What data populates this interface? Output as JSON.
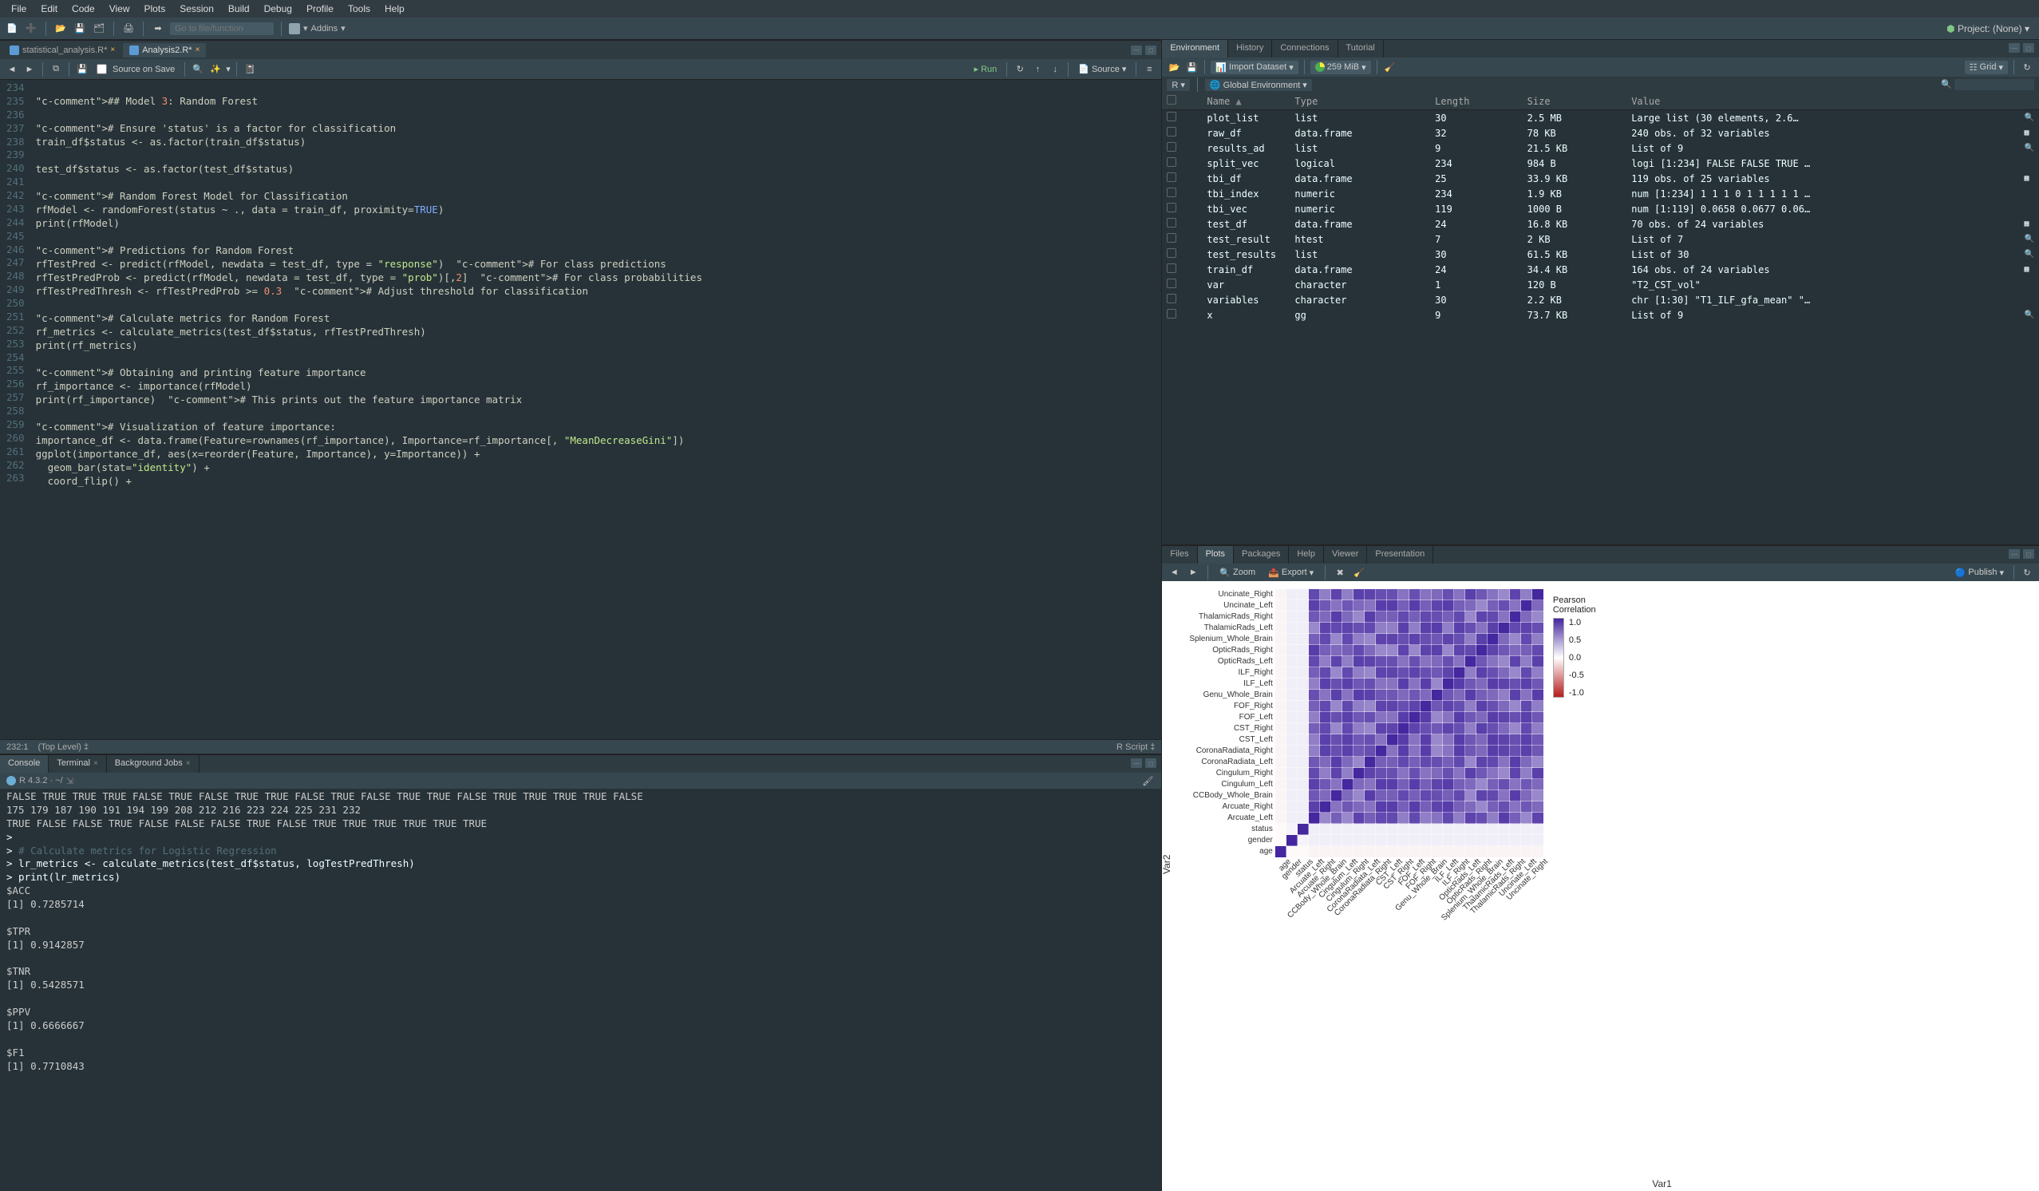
{
  "menu": [
    "File",
    "Edit",
    "Code",
    "View",
    "Plots",
    "Session",
    "Build",
    "Debug",
    "Profile",
    "Tools",
    "Help"
  ],
  "goto_placeholder": "Go to file/function",
  "addins_label": "Addins",
  "project_label": "Project: (None)",
  "editor": {
    "tabs": [
      "statistical_analysis.R*",
      "Analysis2.R*"
    ],
    "active_tab": 1,
    "source_on_save": "Source on Save",
    "run_label": "Run",
    "source_label": "Source",
    "cursor": "232:1",
    "scope": "(Top Level)",
    "lang": "R Script",
    "first_line": 234,
    "lines": [
      "",
      "## Model 3: Random Forest",
      "",
      "# Ensure 'status' is a factor for classification",
      "train_df$status <- as.factor(train_df$status)",
      "",
      "test_df$status <- as.factor(test_df$status)",
      "",
      "# Random Forest Model for Classification",
      "rfModel <- randomForest(status ~ ., data = train_df, proximity=TRUE)",
      "print(rfModel)",
      "",
      "# Predictions for Random Forest",
      "rfTestPred <- predict(rfModel, newdata = test_df, type = \"response\")  # For class predictions",
      "rfTestPredProb <- predict(rfModel, newdata = test_df, type = \"prob\")[,2]  # For class probabilities",
      "rfTestPredThresh <- rfTestPredProb >= 0.3  # Adjust threshold for classification",
      "",
      "# Calculate metrics for Random Forest",
      "rf_metrics <- calculate_metrics(test_df$status, rfTestPredThresh)",
      "print(rf_metrics)",
      "",
      "# Obtaining and printing feature importance",
      "rf_importance <- importance(rfModel)",
      "print(rf_importance)  # This prints out the feature importance matrix",
      "",
      "# Visualization of feature importance:",
      "importance_df <- data.frame(Feature=rownames(rf_importance), Importance=rf_importance[, \"MeanDecreaseGini\"])",
      "ggplot(importance_df, aes(x=reorder(Feature, Importance), y=Importance)) +",
      "  geom_bar(stat=\"identity\") +",
      "  coord_flip() +"
    ]
  },
  "console": {
    "tabs": [
      "Console",
      "Terminal",
      "Background Jobs"
    ],
    "version": "R 4.3.2 · ~/",
    "lines": [
      "FALSE  TRUE  TRUE  TRUE FALSE  TRUE FALSE  TRUE  TRUE FALSE  TRUE FALSE  TRUE  TRUE FALSE  TRUE  TRUE  TRUE  TRUE FALSE",
      "  175   179   187   190   191   194   199   208   212   216   223   224   225   231   232",
      " TRUE FALSE FALSE  TRUE FALSE FALSE FALSE  TRUE FALSE  TRUE  TRUE  TRUE  TRUE  TRUE  TRUE",
      ">",
      "> # Calculate metrics for Logistic Regression",
      "> lr_metrics <- calculate_metrics(test_df$status, logTestPredThresh)",
      "> print(lr_metrics)",
      "$ACC",
      "[1] 0.7285714",
      "",
      "$TPR",
      "[1] 0.9142857",
      "",
      "$TNR",
      "[1] 0.5428571",
      "",
      "$PPV",
      "[1] 0.6666667",
      "",
      "$F1",
      "[1] 0.7710843"
    ]
  },
  "env": {
    "tabs": [
      "Environment",
      "History",
      "Connections",
      "Tutorial"
    ],
    "import_label": "Import Dataset",
    "mem": "259 MiB",
    "view_label": "Grid",
    "scope": "Global Environment",
    "r_label": "R",
    "headers": [
      "",
      "Name",
      "Type",
      "Length",
      "Size",
      "Value"
    ],
    "rows": [
      {
        "name": "plot_list",
        "type": "list",
        "length": "30",
        "size": "2.5 MB",
        "value": "Large list (30 elements, 2.6…",
        "mag": true
      },
      {
        "name": "raw_df",
        "type": "data.frame",
        "length": "32",
        "size": "78 KB",
        "value": "240 obs. of 32 variables",
        "mag": false,
        "grid": true
      },
      {
        "name": "results_ad",
        "type": "list",
        "length": "9",
        "size": "21.5 KB",
        "value": "List of 9",
        "mag": true
      },
      {
        "name": "split_vec",
        "type": "logical",
        "length": "234",
        "size": "984 B",
        "value": "logi [1:234] FALSE FALSE TRUE …",
        "mag": false
      },
      {
        "name": "tbi_df",
        "type": "data.frame",
        "length": "25",
        "size": "33.9 KB",
        "value": "119 obs. of 25 variables",
        "mag": false,
        "grid": true
      },
      {
        "name": "tbi_index",
        "type": "numeric",
        "length": "234",
        "size": "1.9 KB",
        "value": "num [1:234] 1 1 1 0 1 1 1 1 1 …",
        "mag": false
      },
      {
        "name": "tbi_vec",
        "type": "numeric",
        "length": "119",
        "size": "1000 B",
        "value": "num [1:119] 0.0658 0.0677 0.06…",
        "mag": false
      },
      {
        "name": "test_df",
        "type": "data.frame",
        "length": "24",
        "size": "16.8 KB",
        "value": "70 obs. of 24 variables",
        "mag": false,
        "grid": true
      },
      {
        "name": "test_result",
        "type": "htest",
        "length": "7",
        "size": "2 KB",
        "value": "List of 7",
        "mag": true
      },
      {
        "name": "test_results",
        "type": "list",
        "length": "30",
        "size": "61.5 KB",
        "value": "List of 30",
        "mag": true
      },
      {
        "name": "train_df",
        "type": "data.frame",
        "length": "24",
        "size": "34.4 KB",
        "value": "164 obs. of 24 variables",
        "mag": false,
        "grid": true
      },
      {
        "name": "var",
        "type": "character",
        "length": "1",
        "size": "120 B",
        "value": "\"T2_CST_vol\"",
        "mag": false
      },
      {
        "name": "variables",
        "type": "character",
        "length": "30",
        "size": "2.2 KB",
        "value": "chr [1:30] \"T1_ILF_gfa_mean\" \"…",
        "mag": false
      },
      {
        "name": "x",
        "type": "gg",
        "length": "9",
        "size": "73.7 KB",
        "value": "List of 9",
        "mag": true
      }
    ]
  },
  "plots": {
    "tabs": [
      "Files",
      "Plots",
      "Packages",
      "Help",
      "Viewer",
      "Presentation"
    ],
    "zoom_label": "Zoom",
    "export_label": "Export",
    "publish_label": "Publish"
  },
  "chart_data": {
    "type": "heatmap",
    "title": "",
    "xlabel": "Var1",
    "ylabel": "Var2",
    "legend_title": "Pearson\nCorrelation",
    "value_range": [
      -1.0,
      1.0
    ],
    "ticks": [
      "1.0",
      "0.5",
      "0.0",
      "-0.5",
      "-1.0"
    ],
    "row_labels": [
      "Uncinate_Right",
      "Uncinate_Left",
      "ThalamicRads_Right",
      "ThalamicRads_Left",
      "Splenium_Whole_Brain",
      "OpticRads_Right",
      "OpticRads_Left",
      "ILF_Right",
      "ILF_Left",
      "Genu_Whole_Brain",
      "FOF_Right",
      "FOF_Left",
      "CST_Right",
      "CST_Left",
      "CoronaRadiata_Right",
      "CoronaRadiata_Left",
      "Cingulum_Right",
      "Cingulum_Left",
      "CCBody_Whole_Brain",
      "Arcuate_Right",
      "Arcuate_Left",
      "status",
      "gender",
      "age"
    ],
    "col_labels": [
      "age",
      "gender",
      "status",
      "Arcuate_Left",
      "Arcuate_Right",
      "CCBody_Whole_Brain",
      "Cingulum_Left",
      "Cingulum_Right",
      "CoronaRadiata_Left",
      "CoronaRadiata_Right",
      "CST_Left",
      "CST_Right",
      "FOF_Left",
      "FOF_Right",
      "Genu_Whole_Brain",
      "ILF_Left",
      "ILF_Right",
      "OpticRads_Left",
      "OpticRads_Right",
      "Splenium_Whole_Brain",
      "ThalamicRads_Left",
      "ThalamicRads_Right",
      "Uncinate_Left",
      "Uncinate_Right"
    ],
    "note": "Values are Pearson correlations estimated from color. Brain tracts correlate strongly (~0.5–0.9) with one another; status/gender/age show near-zero correlation with tracts; diagonal = 1.0."
  }
}
